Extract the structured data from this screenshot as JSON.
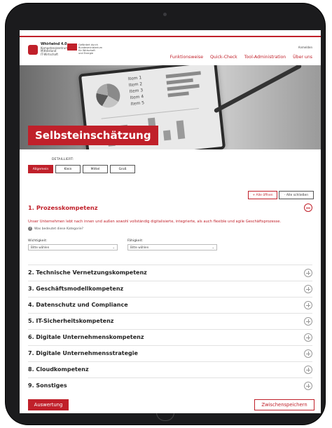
{
  "header": {
    "logo": {
      "title": "Whirlwind 4.0",
      "subtitle": "Kompetenzzentrum Mittelstand",
      "sub2": "IT-Wirtschaft"
    },
    "partner": {
      "line1": "Gefördert durch",
      "line2": "Bundesministerium",
      "line3": "für Wirtschaft",
      "line4": "und Energie"
    },
    "lang": "Anmelden",
    "nav": [
      "Funktionsweise",
      "Quick-Check",
      "Tool-Administration",
      "Über uns"
    ]
  },
  "hero": {
    "items": [
      "Item 1",
      "Item 2",
      "Item 3",
      "Item 4",
      "Item 5"
    ],
    "title": "Selbsteinschätzung"
  },
  "filter": {
    "label": "DETAILLIERT:",
    "options": [
      "Allgemein",
      "Klein",
      "Mittel",
      "Groß"
    ],
    "active": "Allgemein"
  },
  "controls": {
    "open_all": "+ Alle öffnen",
    "close_all": "- Alle schließen"
  },
  "section1": {
    "title": "1. Prozesskompetenz",
    "description": "Unser Unternehmen lebt nach innen und außen sowohl vollständig digitalisierte, integrierte, als auch flexible und agile Geschäftsprozesse.",
    "hint": "Was bedeutet diese Kategorie?",
    "fields": [
      {
        "label": "Wichtigkeit:",
        "value": "Bitte wählen"
      },
      {
        "label": "Fähigkeit:",
        "value": "Bitte wählen"
      }
    ]
  },
  "sections": [
    "2. Technische Vernetzungskompetenz",
    "3. Geschäftsmodellkompetenz",
    "4. Datenschutz und Compliance",
    "5. IT-Sicherheitskompetenz",
    "6. Digitale Unternehmenskompetenz",
    "7. Digitale Unternehmensstrategie",
    "8. Cloudkompetenz",
    "9. Sonstiges"
  ],
  "footer": {
    "evaluate": "Auswertung",
    "save": "Zwischenspeichern"
  }
}
